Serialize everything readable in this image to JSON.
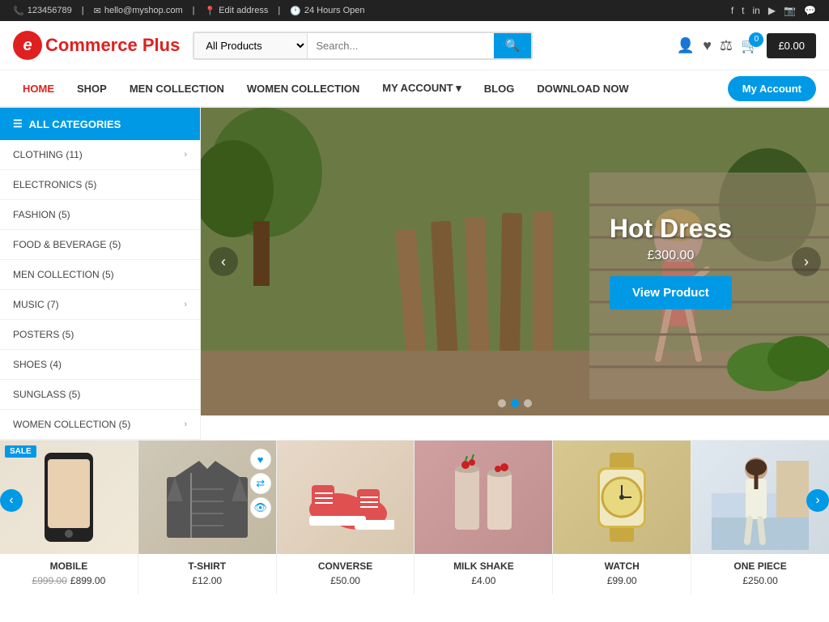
{
  "topbar": {
    "phone": "123456789",
    "email": "hello@myshop.com",
    "address": "Edit address",
    "hours": "24 Hours Open",
    "socials": [
      "facebook",
      "twitter",
      "linkedin",
      "youtube",
      "instagram",
      "whatsapp"
    ]
  },
  "header": {
    "logo_letter": "e",
    "logo_name": "Commerce",
    "logo_plus": "Plus",
    "search_placeholder": "Search...",
    "search_dropdown_default": "All Products",
    "cart_amount": "£0.00",
    "cart_count": "0"
  },
  "nav": {
    "items": [
      {
        "label": "HOME",
        "active": true
      },
      {
        "label": "SHOP",
        "active": false
      },
      {
        "label": "MEN COLLECTION",
        "active": false
      },
      {
        "label": "WOMEN COLLECTION",
        "active": false
      },
      {
        "label": "MY ACCOUNT",
        "active": false,
        "has_dropdown": true
      },
      {
        "label": "BLOG",
        "active": false
      },
      {
        "label": "DOWNLOAD NOW",
        "active": false
      }
    ],
    "account_btn": "My Account"
  },
  "sidebar": {
    "header": "ALL CATEGORIES",
    "items": [
      {
        "label": "CLOTHING (11)",
        "has_arrow": true
      },
      {
        "label": "ELECTRONICS (5)",
        "has_arrow": false
      },
      {
        "label": "FASHION (5)",
        "has_arrow": false
      },
      {
        "label": "FOOD & BEVERAGE (5)",
        "has_arrow": false
      },
      {
        "label": "MEN COLLECTION (5)",
        "has_arrow": false
      },
      {
        "label": "MUSIC (7)",
        "has_arrow": true
      },
      {
        "label": "POSTERS (5)",
        "has_arrow": false
      },
      {
        "label": "SHOES (4)",
        "has_arrow": false
      },
      {
        "label": "SUNGLASS (5)",
        "has_arrow": false
      },
      {
        "label": "WOMEN COLLECTION (5)",
        "has_arrow": true
      }
    ]
  },
  "hero": {
    "title": "Hot Dress",
    "price": "£300.00",
    "btn_label": "View Product",
    "dots": [
      1,
      2,
      3
    ],
    "active_dot": 2
  },
  "products": [
    {
      "name": "MOBILE",
      "price_old": "£999.00",
      "price_new": "£899.00",
      "sale": true,
      "class": "prod-mobile"
    },
    {
      "name": "T-SHIRT",
      "price_old": "",
      "price_new": "£12.00",
      "sale": false,
      "class": "prod-tshirt"
    },
    {
      "name": "CONVERSE",
      "price_old": "",
      "price_new": "£50.00",
      "sale": false,
      "class": "prod-converse"
    },
    {
      "name": "MILK SHAKE",
      "price_old": "",
      "price_new": "£4.00",
      "sale": false,
      "class": "prod-milkshake"
    },
    {
      "name": "WATCH",
      "price_old": "",
      "price_new": "£99.00",
      "sale": false,
      "class": "prod-watch"
    },
    {
      "name": "ONE PIECE",
      "price_old": "",
      "price_new": "£250.00",
      "sale": false,
      "class": "prod-onepiece"
    }
  ]
}
